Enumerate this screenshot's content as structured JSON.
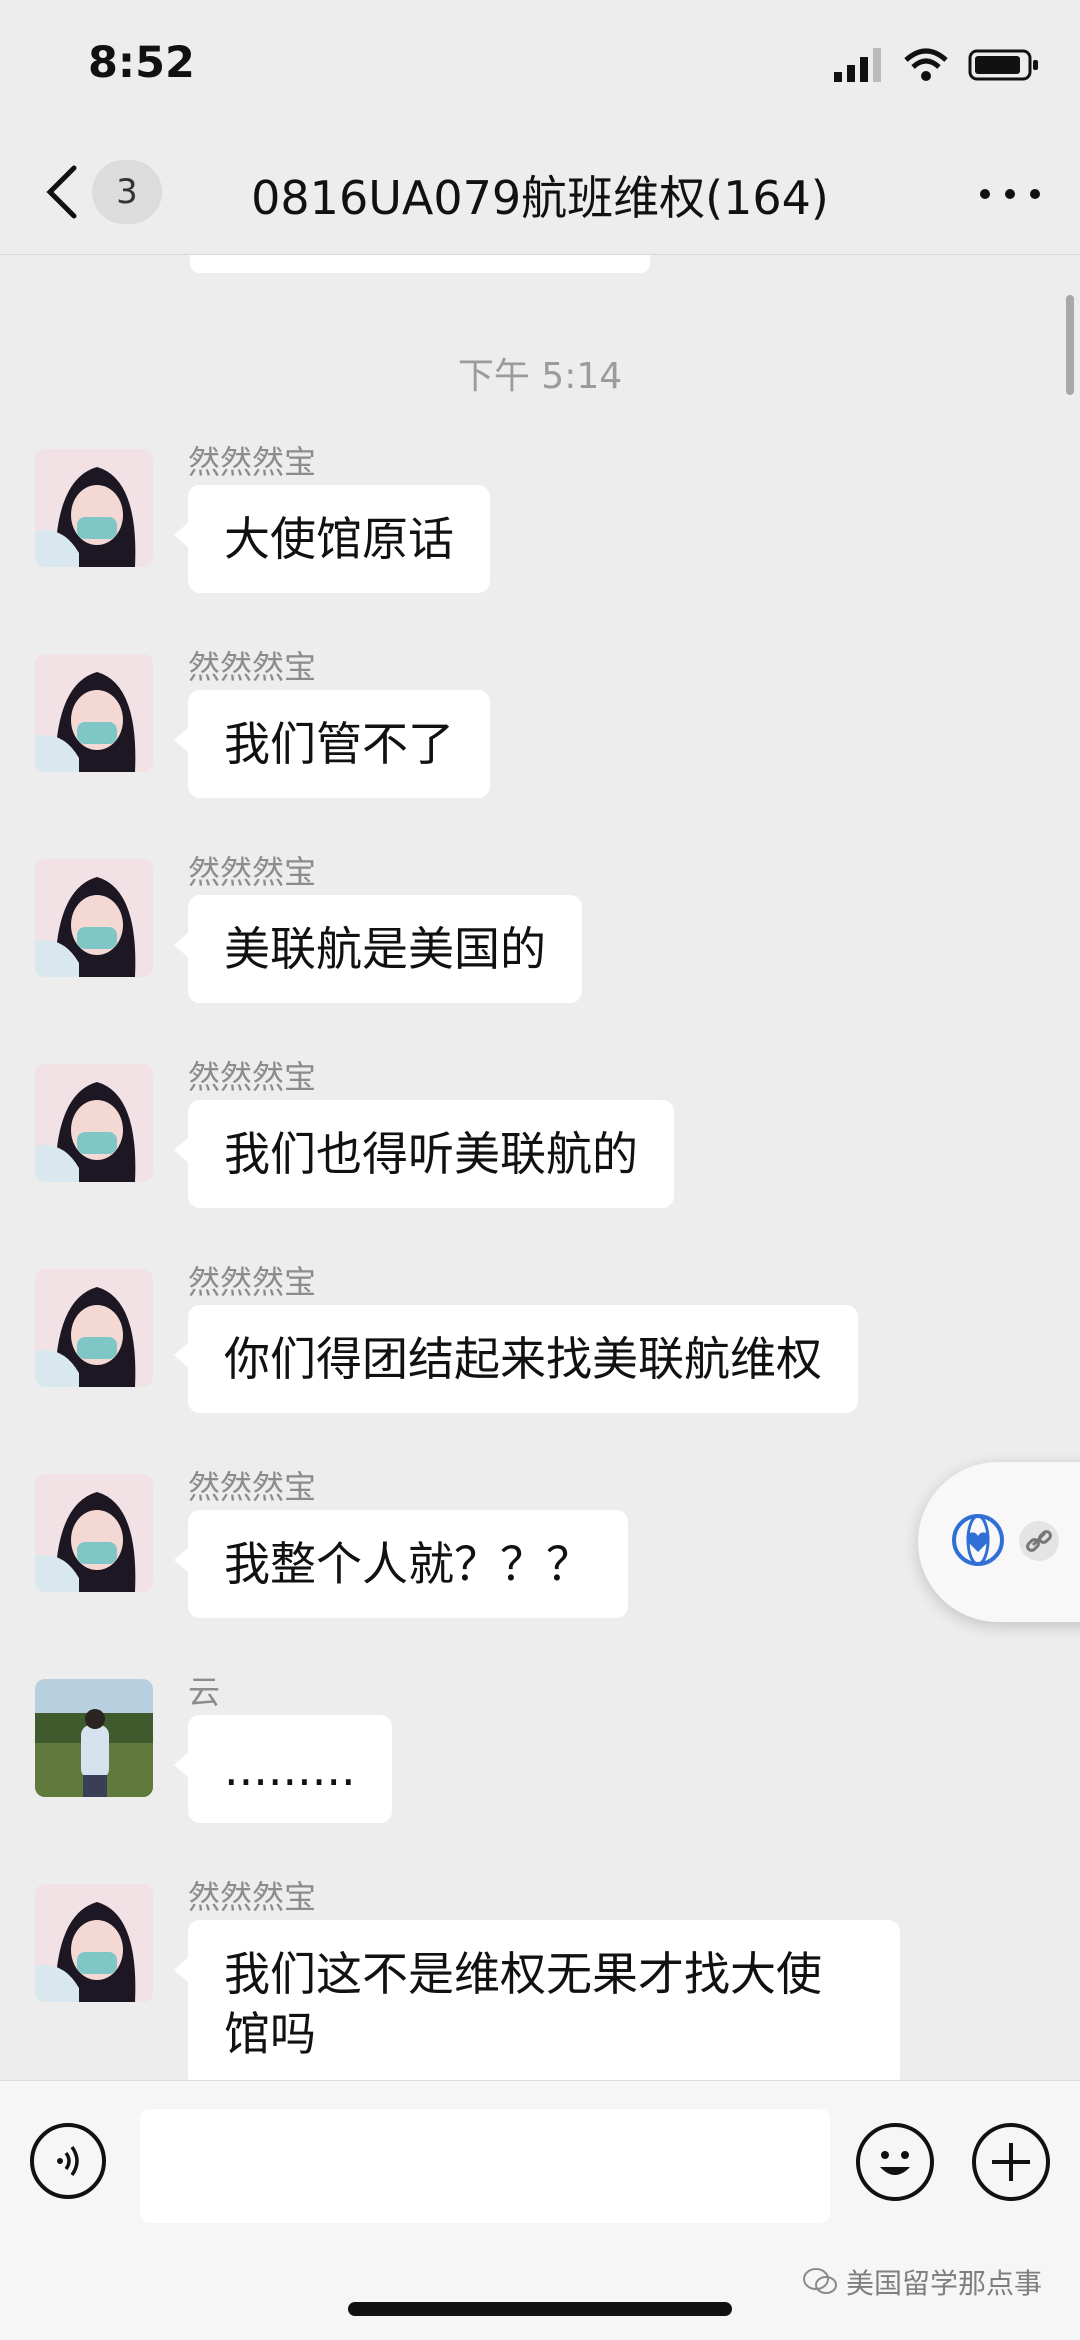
{
  "status_bar": {
    "time": "8:52"
  },
  "nav": {
    "badge": "3",
    "title": "0816UA079航班维权(164)"
  },
  "timestamp": "下午 5:14",
  "messages": [
    {
      "sender": "然然然宝",
      "text": "大使馆原话"
    },
    {
      "sender": "然然然宝",
      "text": "我们管不了"
    },
    {
      "sender": "然然然宝",
      "text": "美联航是美国的"
    },
    {
      "sender": "然然然宝",
      "text": "我们也得听美联航的"
    },
    {
      "sender": "然然然宝",
      "text": "你们得团结起来找美联航维权"
    },
    {
      "sender": "然然然宝",
      "text": "我整个人就？？？"
    },
    {
      "sender": "云",
      "text": "........."
    },
    {
      "sender": "然然然宝",
      "text": "我们这不是维权无果才找大使馆吗"
    }
  ],
  "watermark": "美国留学那点事",
  "icons": {
    "back": "chevron-left-icon",
    "more": "more-dots-icon",
    "voice": "voice-icon",
    "emoji": "emoji-icon",
    "plus": "plus-icon"
  }
}
